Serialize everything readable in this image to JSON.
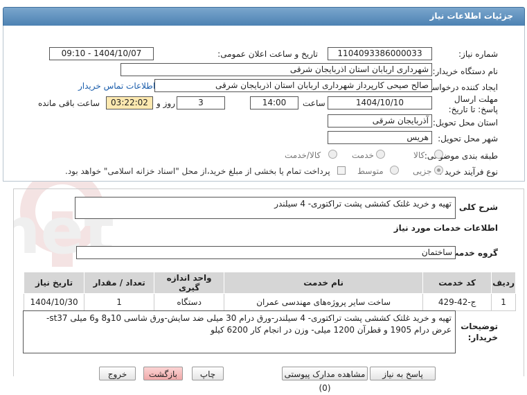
{
  "window": {
    "title": "جزئیات اطلاعات نیاز"
  },
  "fields": {
    "need_number_label": "شماره نیاز:",
    "need_number": "1104093386000033",
    "announce_label": "تاریخ و ساعت اعلان عمومی:",
    "announce_value": "1404/10/07 - 09:10",
    "buyer_org_label": "نام دستگاه خریدار:",
    "buyer_org": "شهرداری اربابان استان اذربایجان شرقی",
    "creator_label": "ایجاد کننده درخواست:",
    "creator": "صالح صیحی کارپرداز شهرداری اربابان استان اذربایجان شرقی",
    "contact_link": "اطلاعات تماس خریدار",
    "deadline_label": "مهلت ارسال پاسخ: تا تاریخ:",
    "deadline_date": "1404/10/10",
    "time_label": "ساعت",
    "deadline_time": "14:00",
    "days_value": "3",
    "days_label": "روز و",
    "remaining_time": "03:22:02",
    "remaining_label": "ساعت باقی مانده",
    "province_label": "استان محل تحویل:",
    "province": "آذربایجان شرقی",
    "city_label": "شهر محل تحویل:",
    "city": "هریس",
    "category_label": "طبقه بندی موضوعی:",
    "category_options": [
      "کالا",
      "خدمت",
      "کالا/خدمت"
    ],
    "process_label": "نوع فرآیند خرید :",
    "process_options": [
      "جزیی",
      "متوسط"
    ],
    "payment_note": "پرداخت تمام یا بخشی از مبلغ خرید،از محل \"اسناد خزانه اسلامی\" خواهد بود."
  },
  "summary": {
    "label": "شرح کلی نیاز:",
    "value": "تهیه و خرید غلتک کششی پشت تراکتوری- 4 سیلندر"
  },
  "services_title": "اطلاعات خدمات مورد نیاز",
  "service_group": {
    "label": "گروه خدمت:",
    "value": "ساختمان"
  },
  "table": {
    "headers": [
      "ردیف",
      "کد خدمت",
      "نام خدمت",
      "واحد اندازه گیری",
      "تعداد / مقدار",
      "تاریخ نیاز"
    ],
    "rows": [
      [
        "1",
        "ج-42-429",
        "ساخت سایر پروژه‌های مهندسی عمران",
        "دستگاه",
        "1",
        "1404/10/30"
      ]
    ]
  },
  "buyer_notes": {
    "label": "توضیحات خریدار:",
    "line1": "تهیه و خرید غلتک کششی پشت تراکتوری- 4 سیلندر-ورق درام 30 میلی ضد سایش-ورق شاسی 10و8 و6 میلی st37-",
    "line2": "عرض درام 1905 و قطرآن 1200 میلی- وزن در انجام کار 6200 کیلو"
  },
  "buttons": {
    "reply": "پاسخ به نیاز",
    "docs": "مشاهده مدارک پیوستی (0)",
    "print": "چاپ",
    "back": "بازگشت",
    "exit": "خروج"
  },
  "watermark": "AriaTender.net",
  "colors": {
    "title_bar": "#5b8fc0",
    "remaining_bg": "#fde9b0",
    "link": "#1a5dab",
    "back_btn": "#f3b4b4"
  }
}
